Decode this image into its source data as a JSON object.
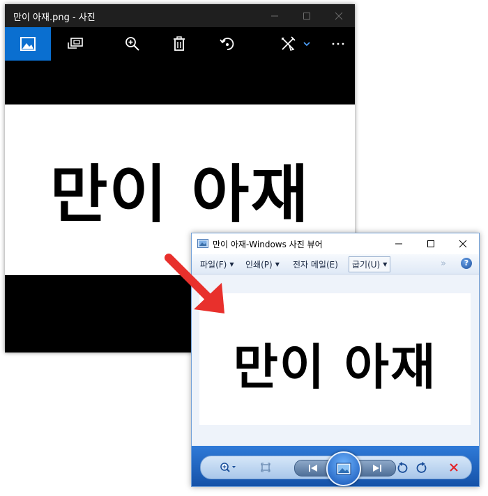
{
  "photos_app": {
    "title": "만이 아재.png - 사진",
    "image_text": "만이 아재",
    "toolbar_icons": [
      "picture-icon",
      "slideshow-icon",
      "zoom-in-icon",
      "trash-icon",
      "rotate-icon",
      "edit-icon",
      "chevron-down-icon",
      "more-icon"
    ],
    "accent": "#0a6fd0"
  },
  "photo_viewer": {
    "title": "만이 아재-Windows 사진 뷰어",
    "menu": {
      "file": "파일(F)",
      "print": "인쇄(P)",
      "email": "전자 메일(E)",
      "burn": "굽기(U)",
      "overflow": "»",
      "help": "?"
    },
    "image_text": "만이 아재",
    "controls": [
      "zoom-icon",
      "actual-size-icon",
      "previous-icon",
      "slideshow-icon",
      "next-icon",
      "rotate-ccw-icon",
      "rotate-cw-icon",
      "delete-icon"
    ],
    "accent": "#1f63c0"
  },
  "annotation": {
    "arrow_color": "#e8302c"
  }
}
